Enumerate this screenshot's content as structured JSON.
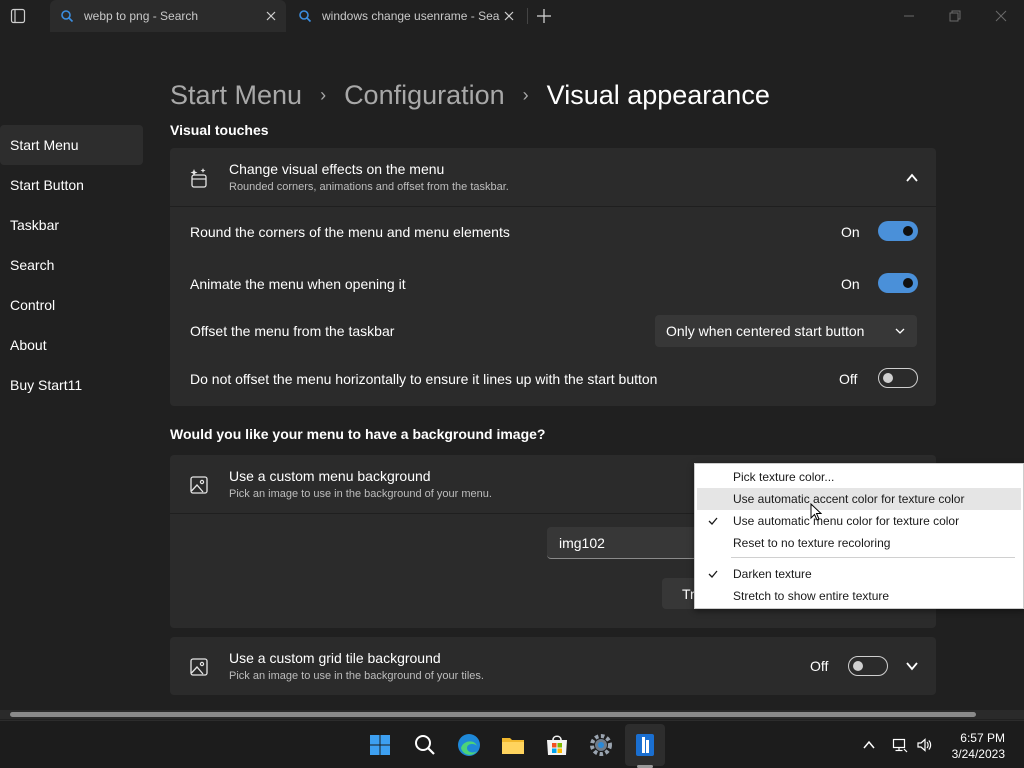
{
  "browser": {
    "tabs": [
      {
        "label": "webp to png - Search"
      },
      {
        "label": "windows change usenrame - Sea"
      }
    ]
  },
  "sidebar": {
    "items": [
      {
        "label": "Start Menu",
        "active": true
      },
      {
        "label": "Start Button"
      },
      {
        "label": "Taskbar"
      },
      {
        "label": "Search"
      },
      {
        "label": "Control"
      },
      {
        "label": "About"
      },
      {
        "label": "Buy Start11"
      }
    ]
  },
  "breadcrumb": {
    "items": [
      "Start Menu",
      "Configuration",
      "Visual appearance"
    ],
    "separator": "›"
  },
  "sections": {
    "visual_touches": "Visual touches",
    "background_question": "Would you like your menu to have a background image?"
  },
  "visual_effects_card": {
    "title": "Change visual effects on the menu",
    "subtitle": "Rounded corners, animations and offset from the taskbar.",
    "icon": "sparkle-menu-icon",
    "rows": [
      {
        "label": "Round the corners of the menu and menu elements",
        "state": "On",
        "enabled": true
      },
      {
        "label": "Animate the menu when opening it",
        "state": "On",
        "enabled": true
      },
      {
        "label": "Offset the menu from the taskbar",
        "select_value": "Only when centered start button"
      },
      {
        "label": "Do not offset the menu horizontally to ensure it lines up with the start button",
        "state": "Off",
        "enabled": false
      }
    ]
  },
  "menu_background_card": {
    "title": "Use a custom menu background",
    "subtitle": "Pick an image to use in the background of your menu.",
    "icon": "image-icon",
    "image_value": "img102",
    "button_partial_label": "Tr"
  },
  "grid_tile_card": {
    "title": "Use a custom grid tile background",
    "subtitle": "Pick an image to use in the background of your tiles.",
    "icon": "image-icon",
    "state": "Off",
    "enabled": false
  },
  "context_menu": {
    "items": [
      {
        "label": "Pick texture color...",
        "checked": false
      },
      {
        "label": "Use automatic accent color for texture color",
        "checked": false,
        "hover": true
      },
      {
        "label": "Use automatic menu color for texture color",
        "checked": true
      },
      {
        "label": "Reset to no texture recoloring",
        "checked": false
      },
      {
        "label": "Darken texture",
        "checked": true
      },
      {
        "label": "Stretch to show entire texture",
        "checked": false
      }
    ]
  },
  "taskbar": {
    "apps": [
      "windows-start-icon",
      "search-icon",
      "edge-browser-icon",
      "file-explorer-icon",
      "microsoft-store-icon",
      "settings-gear-icon",
      "start11-app-icon"
    ],
    "clock": {
      "time": "6:57 PM",
      "date": "3/24/2023"
    }
  },
  "colors": {
    "accent": "#4a90d9",
    "background": "#202020",
    "card": "#2b2b2b"
  }
}
